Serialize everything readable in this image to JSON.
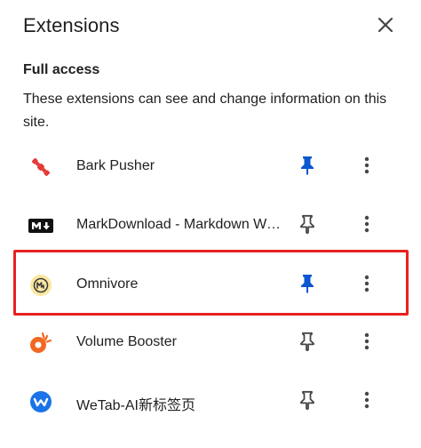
{
  "header": {
    "title": "Extensions",
    "close_icon": "close-icon"
  },
  "section": {
    "title": "Full access",
    "description": "These extensions can see and change information on this site."
  },
  "extensions": [
    {
      "name": "Bark Pusher",
      "icon": "bark-pusher-icon",
      "pinned": true
    },
    {
      "name": "MarkDownload - Markdown Web Clipper",
      "icon": "markdownload-icon",
      "pinned": false
    },
    {
      "name": "Omnivore",
      "icon": "omnivore-icon",
      "pinned": true,
      "highlighted": true
    },
    {
      "name": "Volume Booster",
      "icon": "volume-booster-icon",
      "pinned": false
    },
    {
      "name": "WeTab-AI新标签页",
      "icon": "wetab-icon",
      "pinned": false
    }
  ],
  "colors": {
    "pinned": "#0b57d0",
    "unpinned": "#444746",
    "highlight": "#e8201f",
    "text": "#1f1f1f"
  }
}
